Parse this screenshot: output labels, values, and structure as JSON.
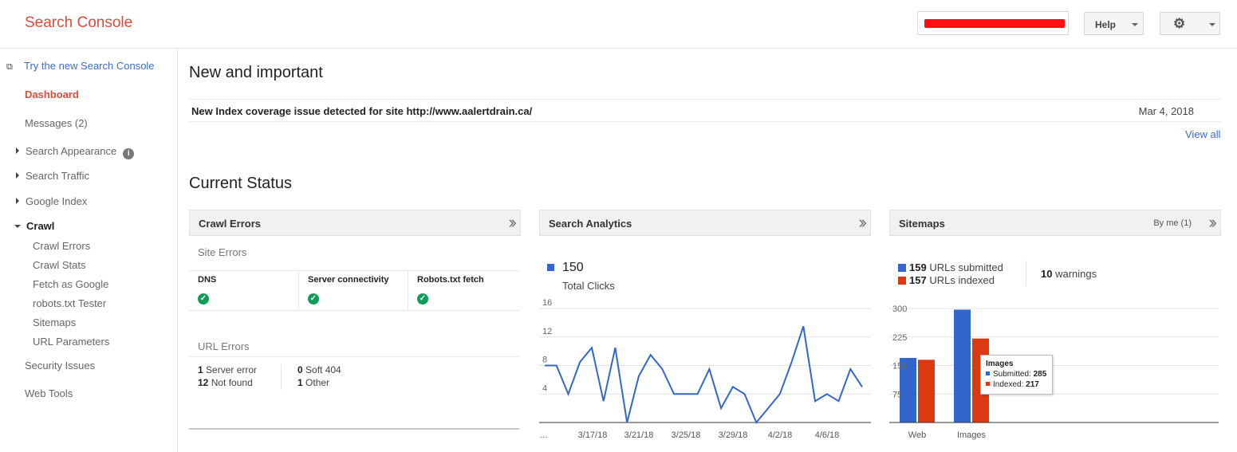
{
  "header": {
    "brand": "Search Console",
    "help_label": "Help",
    "colors": {
      "brand": "#dd4b39",
      "redaction": "#ff1010"
    }
  },
  "sidebar": {
    "try_new": "Try the new Search Console",
    "items": [
      {
        "label": "Dashboard"
      },
      {
        "label": "Messages (2)"
      },
      {
        "label": "Search Appearance"
      },
      {
        "label": "Search Traffic"
      },
      {
        "label": "Google Index"
      },
      {
        "label": "Crawl"
      },
      {
        "label": "Security Issues"
      },
      {
        "label": "Web Tools"
      }
    ],
    "crawl_sub": [
      "Crawl Errors",
      "Crawl Stats",
      "Fetch as Google",
      "robots.txt Tester",
      "Sitemaps",
      "URL Parameters"
    ]
  },
  "main": {
    "new_heading": "New and important",
    "notice": {
      "message": "New Index coverage issue detected for site http://www.aalertdrain.ca/",
      "date": "Mar 4, 2018"
    },
    "view_all": "View all",
    "status_heading": "Current Status"
  },
  "crawl_errors": {
    "title": "Crawl Errors",
    "site_errors_label": "Site Errors",
    "site_errors": [
      {
        "name": "DNS",
        "status": "ok"
      },
      {
        "name": "Server connectivity",
        "status": "ok"
      },
      {
        "name": "Robots.txt fetch",
        "status": "ok"
      }
    ],
    "url_errors_label": "URL Errors",
    "url_errors": [
      {
        "count": "1",
        "label": "Server error"
      },
      {
        "count": "12",
        "label": "Not found"
      },
      {
        "count": "0",
        "label": "Soft 404"
      },
      {
        "count": "1",
        "label": "Other"
      }
    ]
  },
  "search_analytics": {
    "title": "Search Analytics",
    "total_value": "150",
    "total_label": "Total Clicks"
  },
  "sitemaps": {
    "title": "Sitemaps",
    "filter": "By me (1)",
    "submitted_count": "159",
    "submitted_label": "URLs submitted",
    "indexed_count": "157",
    "indexed_label": "URLs indexed",
    "warnings_count": "10",
    "warnings_label": "warnings",
    "tooltip": {
      "title": "Images",
      "submitted_label": "Submitted:",
      "submitted_value": "285",
      "indexed_label": "Indexed:",
      "indexed_value": "217"
    }
  },
  "chart_data": [
    {
      "type": "line",
      "title": "Search Analytics",
      "series": [
        {
          "name": "Total Clicks",
          "color": "#3366cc",
          "values": [
            8,
            8,
            4,
            8.5,
            10.5,
            3,
            10.5,
            0,
            6.5,
            9.5,
            7.5,
            4,
            4,
            4,
            7.5,
            2,
            5,
            4,
            0,
            2,
            4,
            8.5,
            13.5,
            3,
            4,
            3,
            7.5,
            5
          ]
        }
      ],
      "ylim": [
        0,
        16
      ],
      "yticks": [
        4,
        8,
        12,
        16
      ],
      "xtick_labels": [
        "...",
        "3/17/18",
        "3/21/18",
        "3/25/18",
        "3/29/18",
        "4/2/18",
        "4/6/18"
      ],
      "grid": true
    },
    {
      "type": "bar",
      "title": "Sitemaps",
      "categories": [
        "Web",
        "Images"
      ],
      "series": [
        {
          "name": "Submitted",
          "color": "#3366cc",
          "values": [
            170,
            297
          ]
        },
        {
          "name": "Indexed",
          "color": "#dc3912",
          "values": [
            165,
            221
          ]
        }
      ],
      "ylim": [
        0,
        300
      ],
      "yticks": [
        75,
        150,
        225,
        300
      ],
      "grid": true
    }
  ]
}
